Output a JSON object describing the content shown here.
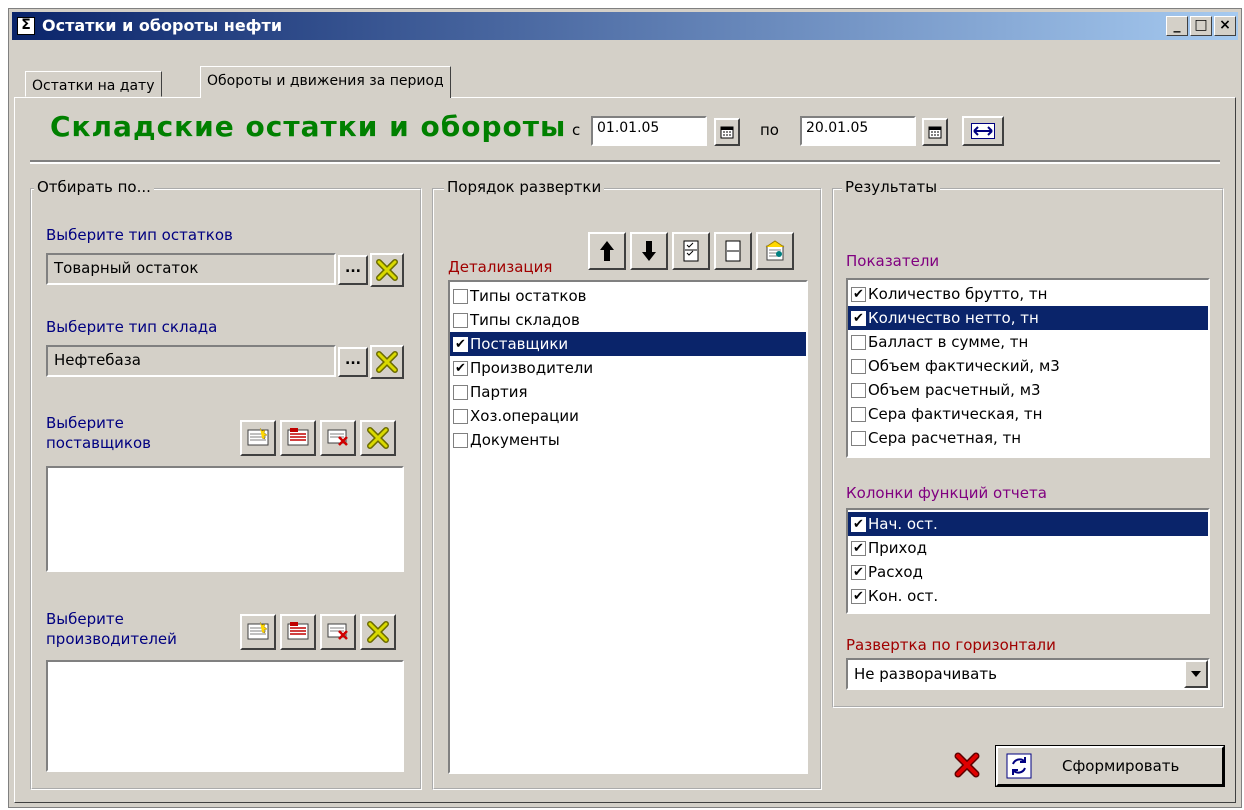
{
  "window": {
    "title": "Остатки и обороты нефти",
    "app_icon": "Σ",
    "minimize": "_",
    "maximize": "□",
    "close": "×"
  },
  "tabs": [
    {
      "label": "Остатки на дату",
      "active": false
    },
    {
      "label": "Обороты и движения за период",
      "active": true
    }
  ],
  "header": {
    "title": "Складские остатки и обороты",
    "from_label": "с",
    "from_value": "01.01.05",
    "to_label": "по",
    "to_value": "20.01.05"
  },
  "filter": {
    "legend": "Отбирать по...",
    "stock_type_label": "Выберите тип остатков",
    "stock_type_value": "Товарный остаток",
    "warehouse_type_label": "Выберите тип склада",
    "warehouse_type_value": "Нефтебаза",
    "suppliers_label_1": "Выберите",
    "suppliers_label_2": "поставщиков",
    "producers_label_1": "Выберите",
    "producers_label_2": "производителей",
    "ellipsis": "..."
  },
  "order": {
    "legend": "Порядок развертки",
    "detail_label": "Детализация",
    "items": [
      {
        "label": "Типы остатков",
        "checked": false,
        "selected": false
      },
      {
        "label": "Типы складов",
        "checked": false,
        "selected": false
      },
      {
        "label": "Поставщики",
        "checked": true,
        "selected": true
      },
      {
        "label": "Производители",
        "checked": true,
        "selected": false
      },
      {
        "label": "Партия",
        "checked": false,
        "selected": false
      },
      {
        "label": "Хоз.операции",
        "checked": false,
        "selected": false
      },
      {
        "label": "Документы",
        "checked": false,
        "selected": false
      }
    ]
  },
  "results": {
    "legend": "Результаты",
    "indicators_label": "Показатели",
    "indicators": [
      {
        "label": "Количество брутто, тн",
        "checked": true,
        "selected": false
      },
      {
        "label": "Количество нетто, тн",
        "checked": true,
        "selected": true
      },
      {
        "label": "Балласт в сумме, тн",
        "checked": false,
        "selected": false
      },
      {
        "label": "Объем фактический, м3",
        "checked": false,
        "selected": false
      },
      {
        "label": "Объем расчетный, м3",
        "checked": false,
        "selected": false
      },
      {
        "label": "Сера фактическая, тн",
        "checked": false,
        "selected": false
      },
      {
        "label": "Сера расчетная, тн",
        "checked": false,
        "selected": false
      }
    ],
    "columns_label": "Колонки функций отчета",
    "columns": [
      {
        "label": "Нач. ост.",
        "checked": true,
        "selected": true
      },
      {
        "label": "Приход",
        "checked": true,
        "selected": false
      },
      {
        "label": "Расход",
        "checked": true,
        "selected": false
      },
      {
        "label": "Кон. ост.",
        "checked": true,
        "selected": false
      }
    ],
    "horizontal_label": "Развертка по горизонтали",
    "horizontal_value": "Не разворачивать"
  },
  "actions": {
    "generate_label": "Сформировать"
  },
  "colors": {
    "title_green": "#008000",
    "label_blue": "#000080",
    "label_red": "#a00000",
    "label_purple": "#800080",
    "selection": "#0a246a"
  }
}
